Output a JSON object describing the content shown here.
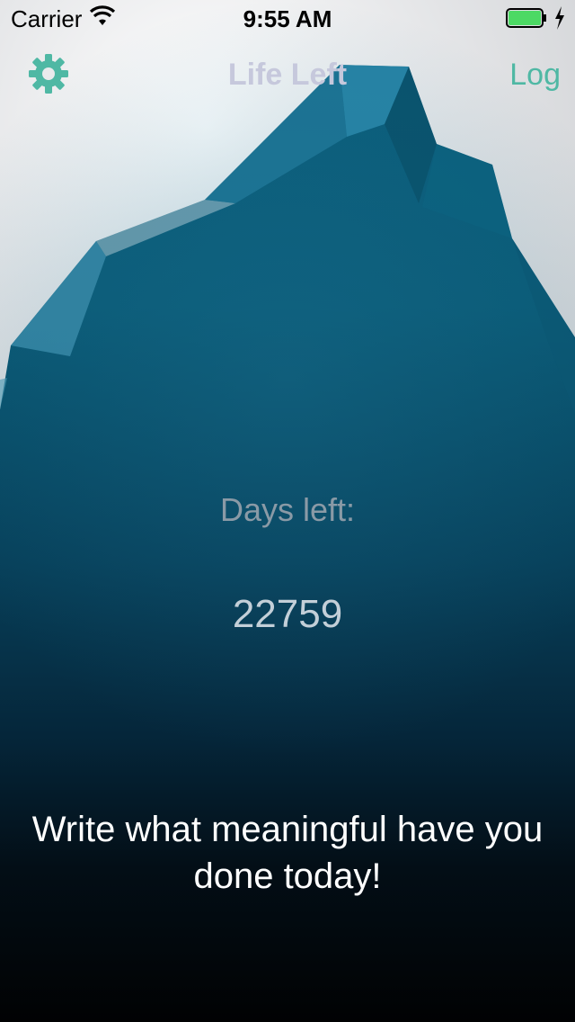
{
  "status_bar": {
    "carrier": "Carrier",
    "time": "9:55 AM",
    "battery_level": 1.0,
    "battery_color": "#4cd964"
  },
  "nav": {
    "title": "Life Left",
    "right_button": "Log",
    "settings_icon": "gear-icon",
    "accent_color": "#4fb8a4"
  },
  "main": {
    "days_label": "Days left:",
    "days_value": "22759",
    "prompt": "Write what meaningful have you done today!"
  },
  "colors": {
    "sky": "#e6e7e9",
    "iceberg": "#0a5a76",
    "deep": "#020406"
  }
}
